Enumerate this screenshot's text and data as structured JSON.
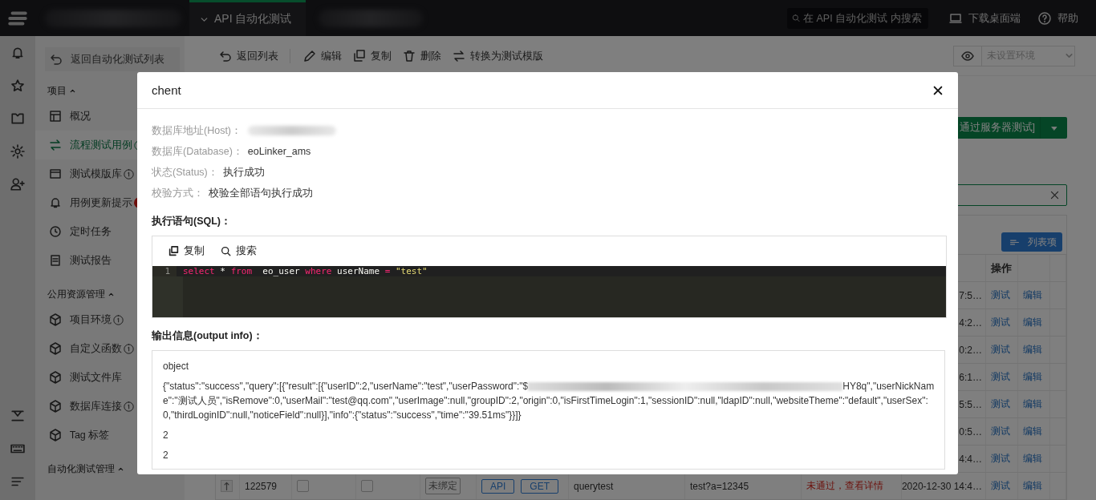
{
  "topbar": {
    "module_tab": "API 自动化测试",
    "search": {
      "placeholder": "在 API 自动化测试 内搜索"
    },
    "links": [
      "下载桌面端",
      "帮助"
    ]
  },
  "sidebar": {
    "back": "返回自动化测试列表",
    "groups": [
      {
        "title": "项目",
        "expanded": true,
        "items": [
          {
            "label": "概况",
            "selected": false,
            "info": false,
            "badge": false
          },
          {
            "label": "流程测试用例",
            "selected": true,
            "info": true,
            "badge": false
          },
          {
            "label": "测试模版库",
            "selected": false,
            "info": true,
            "badge": false
          },
          {
            "label": "用例更新提示",
            "selected": false,
            "info": false,
            "badge": true
          },
          {
            "label": "定时任务",
            "selected": false,
            "info": false,
            "badge": false
          },
          {
            "label": "测试报告",
            "selected": false,
            "info": false,
            "badge": false
          }
        ]
      },
      {
        "title": "公用资源管理",
        "expanded": true,
        "items": [
          {
            "label": "项目环境",
            "selected": false,
            "info": true,
            "badge": false
          },
          {
            "label": "自定义函数",
            "selected": false,
            "info": true,
            "badge": false
          },
          {
            "label": "测试文件库",
            "selected": false,
            "info": false,
            "badge": false
          },
          {
            "label": "数据库连接",
            "selected": false,
            "info": true,
            "badge": false
          },
          {
            "label": "Tag 标签",
            "selected": false,
            "info": false,
            "badge": false
          }
        ]
      },
      {
        "title": "自动化测试管理",
        "expanded": true
      }
    ]
  },
  "toolbar": {
    "actions": [
      "返回列表",
      "编辑",
      "复制",
      "删除",
      "转换为测试模版"
    ],
    "environment": {
      "placeholder": "未设置环境"
    }
  },
  "content": {
    "run_button": "通过服务器测试]",
    "list_button": "列表项",
    "table": {
      "actions_header": "操作",
      "rows": [
        {
          "time": "7:5…",
          "actions": [
            "测试",
            "编辑"
          ]
        },
        {
          "time": "4:2…",
          "actions": [
            "测试",
            "编辑"
          ]
        },
        {
          "time": "0:2…",
          "actions": [
            "测试",
            "编辑"
          ]
        },
        {
          "time": "6:1…",
          "actions": [
            "测试",
            "编辑"
          ]
        },
        {
          "time": "5:5…",
          "actions": [
            "测试",
            "编辑"
          ]
        },
        {
          "time": "0:5…",
          "actions": [
            "测试",
            "编辑"
          ]
        },
        {
          "time": "4:4…",
          "actions": [
            "测试",
            "编辑"
          ]
        },
        {
          "id": "122579",
          "checks": [
            false,
            false
          ],
          "binding": "未绑定",
          "type": "API",
          "method": "GET",
          "name": "querytest",
          "url": "test?a=12345",
          "status": "未通过，查看详情",
          "time": "2020-12-30 14:4…",
          "actions": [
            "测试",
            "编辑"
          ]
        }
      ]
    }
  },
  "dialog": {
    "title": "chent",
    "fields": [
      {
        "label": "数据库地址(Host)：",
        "redacted": true
      },
      {
        "label": "数据库(Database)：",
        "value": "eoLinker_ams",
        "redacted": false
      },
      {
        "label": "状态(Status)：",
        "value": "执行成功",
        "redacted": false
      },
      {
        "label": "校验方式：",
        "value": "校验全部语句执行成功",
        "redacted": false
      }
    ],
    "sql_label": "执行语句(SQL)：",
    "editor_actions": [
      "复制",
      "搜索"
    ],
    "code_lines": [
      {
        "number": "1",
        "tokens": [
          {
            "text": "select",
            "kind": "keyword"
          },
          {
            "text": " * ",
            "kind": "plain"
          },
          {
            "text": "from",
            "kind": "keyword"
          },
          {
            "text": "  eo_user ",
            "kind": "plain"
          },
          {
            "text": "where",
            "kind": "keyword"
          },
          {
            "text": " userName ",
            "kind": "plain"
          },
          {
            "text": "=",
            "kind": "keyword"
          },
          {
            "text": " \"test\"",
            "kind": "string"
          }
        ]
      }
    ],
    "output_label": "输出信息(output info)：",
    "output_lines": [
      {
        "text": "object",
        "redacted": false
      },
      {
        "text": "{\"status\":\"success\",\"query\":[{\"result\":[{\"userID\":2,\"userName\":\"test\",\"userPassword\":\"$",
        "redacted": true,
        "rest": "HY8q\",\"userNickName\":\"测试人员\",\"isRemove\":0,\"userMail\":\"test@qq.com\",\"userImage\":null,\"groupID\":2,\"origin\":0,\"isFirstTimeLogin\":1,\"sessionID\":null,\"ldapID\":null,\"websiteTheme\":\"default\",\"userSex\":0,\"thirdLoginID\":null,\"noticeField\":null}],\"info\":{\"status\":\"success\",\"time\":\"39.51ms\"}}]}"
      },
      {
        "text": "2",
        "redacted": false
      },
      {
        "text": "2",
        "redacted": false
      }
    ]
  }
}
